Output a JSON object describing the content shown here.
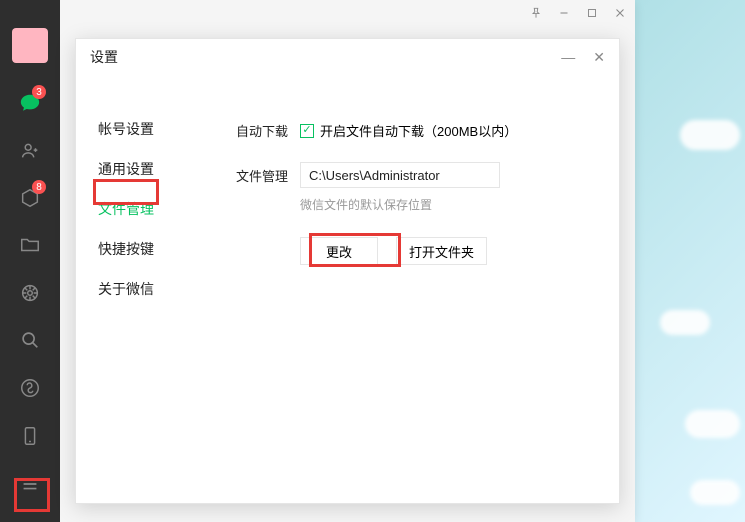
{
  "sidebar": {
    "chat_badge": "3",
    "collections_badge": "8"
  },
  "settings": {
    "title": "设置",
    "nav": {
      "account": "帐号设置",
      "general": "通用设置",
      "files": "文件管理",
      "shortcuts": "快捷按键",
      "about": "关于微信"
    },
    "auto_download": {
      "label": "自动下载",
      "checkbox_text": "开启文件自动下载（200MB以内）"
    },
    "file_mgmt": {
      "label": "文件管理",
      "path": "C:\\Users\\Administrator",
      "hint": "微信文件的默认保存位置",
      "change_btn": "更改",
      "open_btn": "打开文件夹"
    }
  }
}
